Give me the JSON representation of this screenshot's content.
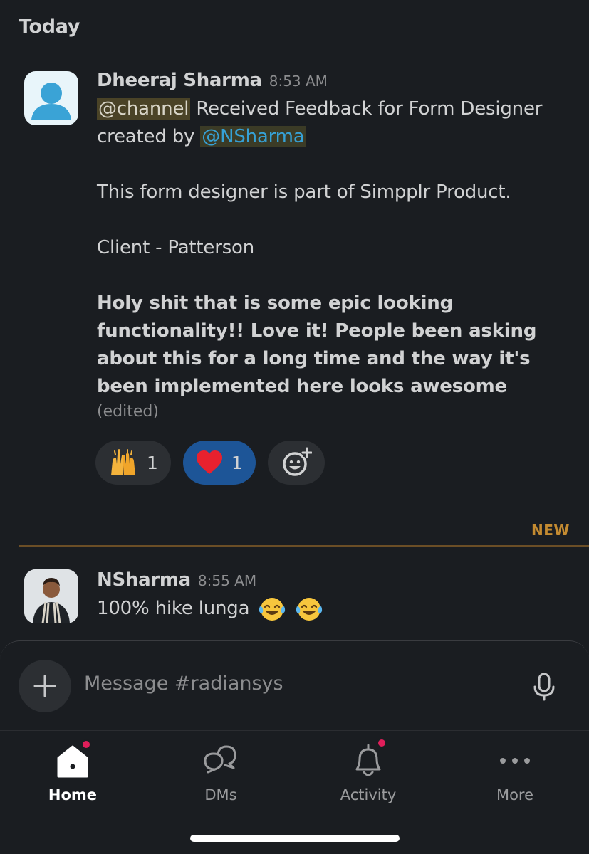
{
  "day_header": "Today",
  "messages": [
    {
      "author": "Dheeraj Sharma",
      "time": "8:53 AM",
      "mention_channel": "@channel",
      "line1_rest": " Received Feedback for Form Designer created by ",
      "mention_user": "@NSharma",
      "paragraph2": "This form designer is part of Simpplr Product.",
      "paragraph3": "Client - Patterson",
      "paragraph4": "Holy shit that is some epic looking functionality!! Love it! People been asking about this for a long time and the way it's been implemented here looks awesome",
      "edited": "(edited)",
      "reactions": [
        {
          "emoji": "raising-hands",
          "count": "1",
          "selected": false
        },
        {
          "emoji": "red-heart",
          "count": "1",
          "selected": true
        }
      ]
    },
    {
      "author": "NSharma",
      "time": "8:55 AM",
      "text": "100% hike lunga"
    }
  ],
  "new_label": "NEW",
  "composer": {
    "placeholder": "Message #radiansys"
  },
  "tabs": [
    {
      "label": "Home",
      "icon": "home-icon",
      "active": true,
      "badge": true
    },
    {
      "label": "DMs",
      "icon": "dms-icon",
      "active": false,
      "badge": false
    },
    {
      "label": "Activity",
      "icon": "bell-icon",
      "active": false,
      "badge": true
    },
    {
      "label": "More",
      "icon": "more-icon",
      "active": false,
      "badge": false
    }
  ],
  "colors": {
    "background": "#1a1d21",
    "selected_reaction": "#1d5597",
    "new_divider": "#c48b31",
    "badge": "#e01e5a",
    "link": "#36a1d6"
  }
}
